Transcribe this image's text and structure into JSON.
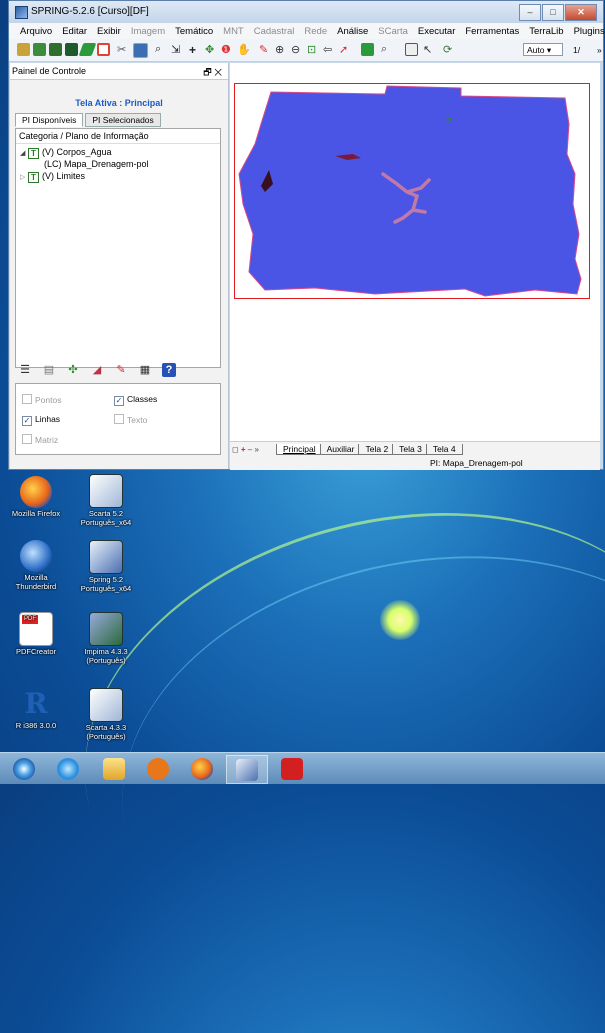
{
  "window": {
    "title": "SPRING-5.2.6 [Curso][DF]",
    "buttons": [
      "–",
      "□",
      "✕"
    ]
  },
  "menu": [
    {
      "label": "Arquivo",
      "enabled": true
    },
    {
      "label": "Editar",
      "enabled": true
    },
    {
      "label": "Exibir",
      "enabled": true
    },
    {
      "label": "Imagem",
      "enabled": false
    },
    {
      "label": "Temático",
      "enabled": true
    },
    {
      "label": "MNT",
      "enabled": false
    },
    {
      "label": "Cadastral",
      "enabled": false
    },
    {
      "label": "Rede",
      "enabled": false
    },
    {
      "label": "Análise",
      "enabled": true
    },
    {
      "label": "SCarta",
      "enabled": false
    },
    {
      "label": "Executar",
      "enabled": true
    },
    {
      "label": "Ferramentas",
      "enabled": true
    },
    {
      "label": "TerraLib",
      "enabled": true
    },
    {
      "label": "Plugins",
      "enabled": true
    },
    {
      "label": "»",
      "enabled": true
    }
  ],
  "toolbar": {
    "zoom_value": "Auto",
    "scale_text": "1/",
    "more": "»"
  },
  "panel": {
    "title": "Painel de Controle",
    "controls": "🗗 ✕",
    "active_screen": "Tela Ativa : Principal",
    "tabs": [
      "PI Disponíveis",
      "PI Selecionados"
    ],
    "tree_header": "Categoria / Plano de Informação",
    "tree": [
      {
        "label": "(V) Corpos_Agua",
        "type": "T",
        "expanded": true
      },
      {
        "label": "(LC) Mapa_Drenagem-pol",
        "type": "child"
      },
      {
        "label": "(V) Limites",
        "type": "T",
        "expanded": false
      }
    ],
    "checkboxes": [
      {
        "label": "Pontos",
        "checked": false,
        "enabled": false
      },
      {
        "label": "Classes",
        "checked": true,
        "enabled": true
      },
      {
        "label": "Linhas",
        "checked": true,
        "enabled": true
      },
      {
        "label": "Texto",
        "checked": false,
        "enabled": false
      },
      {
        "label": "Matriz",
        "checked": false,
        "enabled": false
      }
    ]
  },
  "screen_tabs": {
    "controls": [
      "◻",
      "+",
      "–",
      "»"
    ],
    "tabs": [
      "Principal",
      "Auxiliar",
      "Tela 2",
      "Tela 3",
      "Tela 4"
    ],
    "active": "Principal"
  },
  "status": "PI: Mapa_Drenagem-pol",
  "desktop_icons": [
    {
      "label": "Mozilla Firefox"
    },
    {
      "label": "Scarta 5.2 Português_x64"
    },
    {
      "label": "Mozilla Thunderbird"
    },
    {
      "label": "Spring 5.2 Português_x64"
    },
    {
      "label": "PDFCreator"
    },
    {
      "label": "Impima 4.3.3 (Português)"
    },
    {
      "label": "R i386 3.0.0"
    },
    {
      "label": "Scarta 4.3.3 (Português)"
    }
  ],
  "colors": {
    "map_fill": "#4a55e6",
    "map_border": "#e01c1c",
    "accent": "#1c5bc2"
  }
}
